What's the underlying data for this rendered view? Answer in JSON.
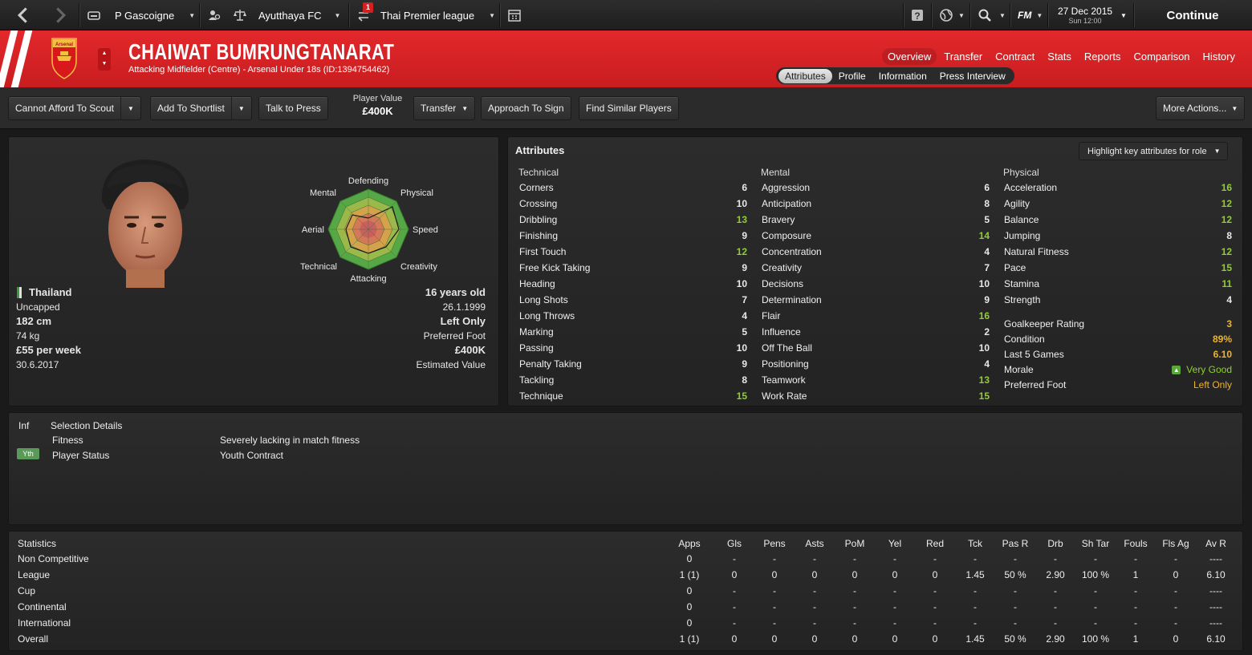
{
  "topbar": {
    "manager": "P Gascoigne",
    "club": "Ayutthaya FC",
    "league": "Thai Premier league",
    "notification_count": "1",
    "fm_label": "FM",
    "date": "27 Dec 2015",
    "time": "Sun 12:00",
    "continue_label": "Continue"
  },
  "player": {
    "name": "CHAIWAT BUMRUNGTANARAT",
    "subtitle": "Attacking Midfielder (Centre) - Arsenal Under 18s (ID:1394754462)",
    "crest_text": "Arsenal"
  },
  "nav": {
    "tabs": [
      "Overview",
      "Transfer",
      "Contract",
      "Stats",
      "Reports",
      "Comparison",
      "History"
    ],
    "subtabs": [
      "Attributes",
      "Profile",
      "Information",
      "Press Interview"
    ]
  },
  "actions": {
    "scout": "Cannot Afford To Scout",
    "shortlist": "Add To Shortlist",
    "press": "Talk to Press",
    "value_label": "Player Value",
    "value": "£400K",
    "transfer": "Transfer",
    "approach": "Approach To Sign",
    "similar": "Find Similar Players",
    "more": "More Actions..."
  },
  "radar": {
    "labels": [
      "Defending",
      "Physical",
      "Speed",
      "Creativity",
      "Attacking",
      "Technical",
      "Aerial",
      "Mental"
    ]
  },
  "bio": {
    "nation": "Thailand",
    "caps": "Uncapped",
    "height": "182 cm",
    "weight": "74 kg",
    "wage": "£55 per week",
    "contract_end": "30.6.2017",
    "age": "16 years old",
    "dob": "26.1.1999",
    "foot": "Left Only",
    "foot_label": "Preferred Foot",
    "value": "£400K",
    "value_label": "Estimated Value"
  },
  "attributes": {
    "title": "Attributes",
    "highlight": "Highlight key attributes for role",
    "technical_header": "Technical",
    "mental_header": "Mental",
    "physical_header": "Physical",
    "technical": [
      {
        "name": "Corners",
        "value": "6"
      },
      {
        "name": "Crossing",
        "value": "10"
      },
      {
        "name": "Dribbling",
        "value": "13"
      },
      {
        "name": "Finishing",
        "value": "9"
      },
      {
        "name": "First Touch",
        "value": "12"
      },
      {
        "name": "Free Kick Taking",
        "value": "9"
      },
      {
        "name": "Heading",
        "value": "10"
      },
      {
        "name": "Long Shots",
        "value": "7"
      },
      {
        "name": "Long Throws",
        "value": "4"
      },
      {
        "name": "Marking",
        "value": "5"
      },
      {
        "name": "Passing",
        "value": "10"
      },
      {
        "name": "Penalty Taking",
        "value": "9"
      },
      {
        "name": "Tackling",
        "value": "8"
      },
      {
        "name": "Technique",
        "value": "15"
      }
    ],
    "mental": [
      {
        "name": "Aggression",
        "value": "6"
      },
      {
        "name": "Anticipation",
        "value": "8"
      },
      {
        "name": "Bravery",
        "value": "5"
      },
      {
        "name": "Composure",
        "value": "14"
      },
      {
        "name": "Concentration",
        "value": "4"
      },
      {
        "name": "Creativity",
        "value": "7"
      },
      {
        "name": "Decisions",
        "value": "10"
      },
      {
        "name": "Determination",
        "value": "9"
      },
      {
        "name": "Flair",
        "value": "16"
      },
      {
        "name": "Influence",
        "value": "2"
      },
      {
        "name": "Off The Ball",
        "value": "10"
      },
      {
        "name": "Positioning",
        "value": "4"
      },
      {
        "name": "Teamwork",
        "value": "13"
      },
      {
        "name": "Work Rate",
        "value": "15"
      }
    ],
    "physical": [
      {
        "name": "Acceleration",
        "value": "16"
      },
      {
        "name": "Agility",
        "value": "12"
      },
      {
        "name": "Balance",
        "value": "12"
      },
      {
        "name": "Jumping",
        "value": "8"
      },
      {
        "name": "Natural Fitness",
        "value": "12"
      },
      {
        "name": "Pace",
        "value": "15"
      },
      {
        "name": "Stamina",
        "value": "11"
      },
      {
        "name": "Strength",
        "value": "4"
      }
    ],
    "extra": [
      {
        "name": "Goalkeeper Rating",
        "value": "3"
      },
      {
        "name": "Condition",
        "value": "89%"
      },
      {
        "name": "Last 5 Games",
        "value": "6.10"
      },
      {
        "name": "Morale",
        "value": "Very Good"
      },
      {
        "name": "Preferred Foot",
        "value": "Left Only"
      }
    ]
  },
  "selection": {
    "col1": "Inf",
    "col2": "Selection Details",
    "rows": [
      {
        "badge": "",
        "label": "Fitness",
        "value": "Severely lacking in match fitness"
      },
      {
        "badge": "Yth",
        "label": "Player Status",
        "value": "Youth Contract"
      }
    ]
  },
  "stats": {
    "title": "Statistics",
    "columns": [
      "Apps",
      "Gls",
      "Pens",
      "Asts",
      "PoM",
      "Yel",
      "Red",
      "Tck",
      "Pas R",
      "Drb",
      "Sh Tar",
      "Fouls",
      "Fls Ag",
      "Av R"
    ],
    "rows": [
      {
        "label": "Non Competitive",
        "cells": [
          "0",
          "-",
          "-",
          "-",
          "-",
          "-",
          "-",
          "-",
          "-",
          "-",
          "-",
          "-",
          "-",
          "----"
        ]
      },
      {
        "label": "League",
        "cells": [
          "1 (1)",
          "0",
          "0",
          "0",
          "0",
          "0",
          "0",
          "1.45",
          "50 %",
          "2.90",
          "100 %",
          "1",
          "0",
          "6.10"
        ]
      },
      {
        "label": "Cup",
        "cells": [
          "0",
          "-",
          "-",
          "-",
          "-",
          "-",
          "-",
          "-",
          "-",
          "-",
          "-",
          "-",
          "-",
          "----"
        ]
      },
      {
        "label": "Continental",
        "cells": [
          "0",
          "-",
          "-",
          "-",
          "-",
          "-",
          "-",
          "-",
          "-",
          "-",
          "-",
          "-",
          "-",
          "----"
        ]
      },
      {
        "label": "International",
        "cells": [
          "0",
          "-",
          "-",
          "-",
          "-",
          "-",
          "-",
          "-",
          "-",
          "-",
          "-",
          "-",
          "-",
          "----"
        ]
      },
      {
        "label": "Overall",
        "cells": [
          "1 (1)",
          "0",
          "0",
          "0",
          "0",
          "0",
          "0",
          "1.45",
          "50 %",
          "2.90",
          "100 %",
          "1",
          "0",
          "6.10"
        ]
      }
    ]
  },
  "colors": {
    "header_red": "#d82225",
    "attr_green": "#8ed12a",
    "attr_orange": "#f0b429"
  }
}
